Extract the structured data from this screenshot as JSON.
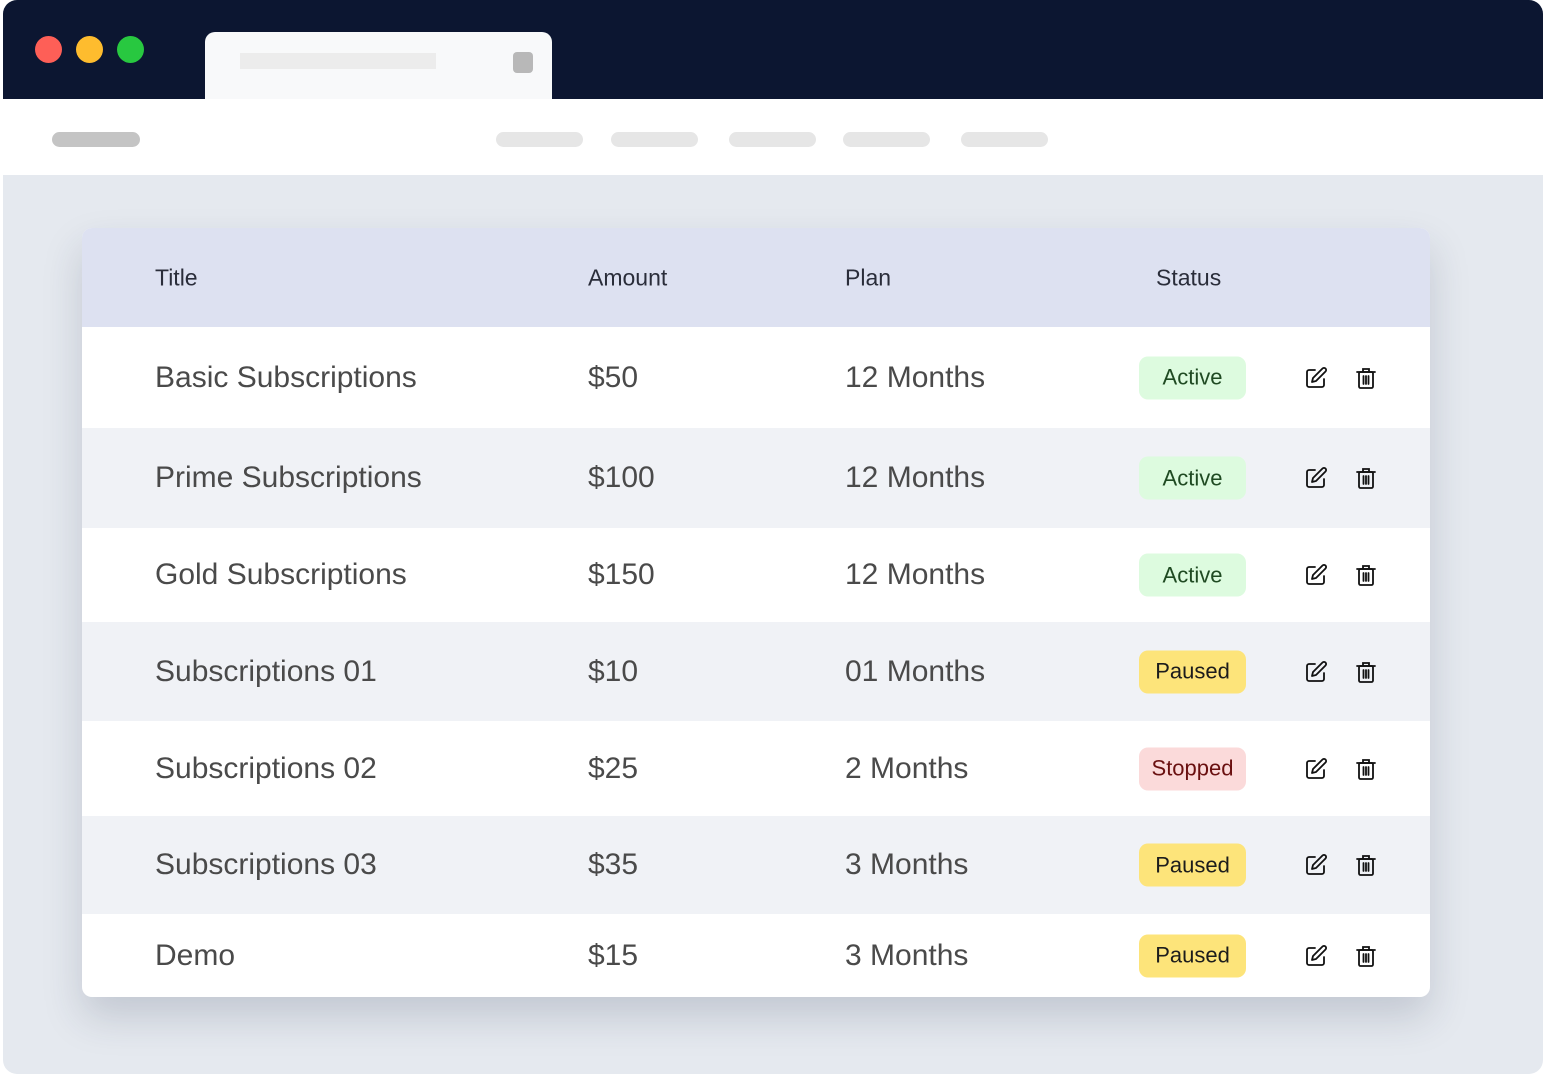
{
  "table": {
    "headers": {
      "title": "Title",
      "amount": "Amount",
      "plan": "Plan",
      "status": "Status"
    },
    "rows": [
      {
        "title": "Basic Subscriptions",
        "amount": "$50",
        "plan": "12 Months",
        "status": "Active"
      },
      {
        "title": "Prime Subscriptions",
        "amount": "$100",
        "plan": "12 Months",
        "status": "Active"
      },
      {
        "title": "Gold Subscriptions",
        "amount": "$150",
        "plan": "12 Months",
        "status": "Active"
      },
      {
        "title": "Subscriptions 01",
        "amount": "$10",
        "plan": "01 Months",
        "status": "Paused"
      },
      {
        "title": "Subscriptions 02",
        "amount": "$25",
        "plan": "2 Months",
        "status": "Stopped"
      },
      {
        "title": "Subscriptions 03",
        "amount": "$35",
        "plan": "3 Months",
        "status": "Paused"
      },
      {
        "title": "Demo",
        "amount": "$15",
        "plan": "3 Months",
        "status": "Paused"
      }
    ]
  },
  "status_colors": {
    "Active": {
      "bg": "#ddfbdf",
      "fg": "#1f4a22"
    },
    "Paused": {
      "bg": "#fde47a",
      "fg": "#1c1c1c"
    },
    "Stopped": {
      "bg": "#fbdada",
      "fg": "#6a1010"
    }
  },
  "icons": {
    "edit": "edit-icon",
    "delete": "trash-icon"
  }
}
